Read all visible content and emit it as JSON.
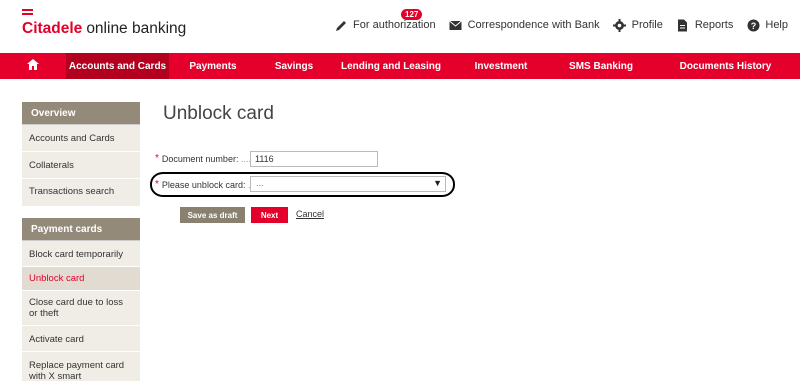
{
  "header": {
    "brand": "Citadele",
    "brand_rest": "online banking",
    "tools": [
      {
        "label": "For authorization",
        "icon": "pencil-icon",
        "badge": "127"
      },
      {
        "label": "Correspondence with Bank",
        "icon": "envelope-icon"
      },
      {
        "label": "Profile",
        "icon": "gear-icon"
      },
      {
        "label": "Reports",
        "icon": "document-icon"
      },
      {
        "label": "Help",
        "icon": "question-icon"
      }
    ]
  },
  "nav": {
    "home_icon": "home-icon",
    "items": [
      "Accounts and Cards",
      "Payments",
      "Savings",
      "Lending and Leasing",
      "Investment",
      "SMS Banking",
      "Documents History"
    ],
    "active_index": 0
  },
  "sidebar": {
    "groups": [
      {
        "title": "Overview",
        "items": [
          "Accounts and Cards",
          "Collaterals",
          "Transactions search"
        ]
      },
      {
        "title": "Payment cards",
        "items": [
          "Block card temporarily",
          "Unblock card",
          "Close card due to loss or theft",
          "Activate card",
          "Replace payment card with X smart"
        ]
      }
    ]
  },
  "main": {
    "title": "Unblock card",
    "document_label": "Document number:",
    "document_value": "1116",
    "unblock_label": "Please unblock card:",
    "unblock_value": "...",
    "save_draft": "Save as draft",
    "next": "Next",
    "cancel": "Cancel"
  },
  "colors": {
    "brand_red": "#e4002b",
    "sidebar_head": "#948a7a"
  }
}
